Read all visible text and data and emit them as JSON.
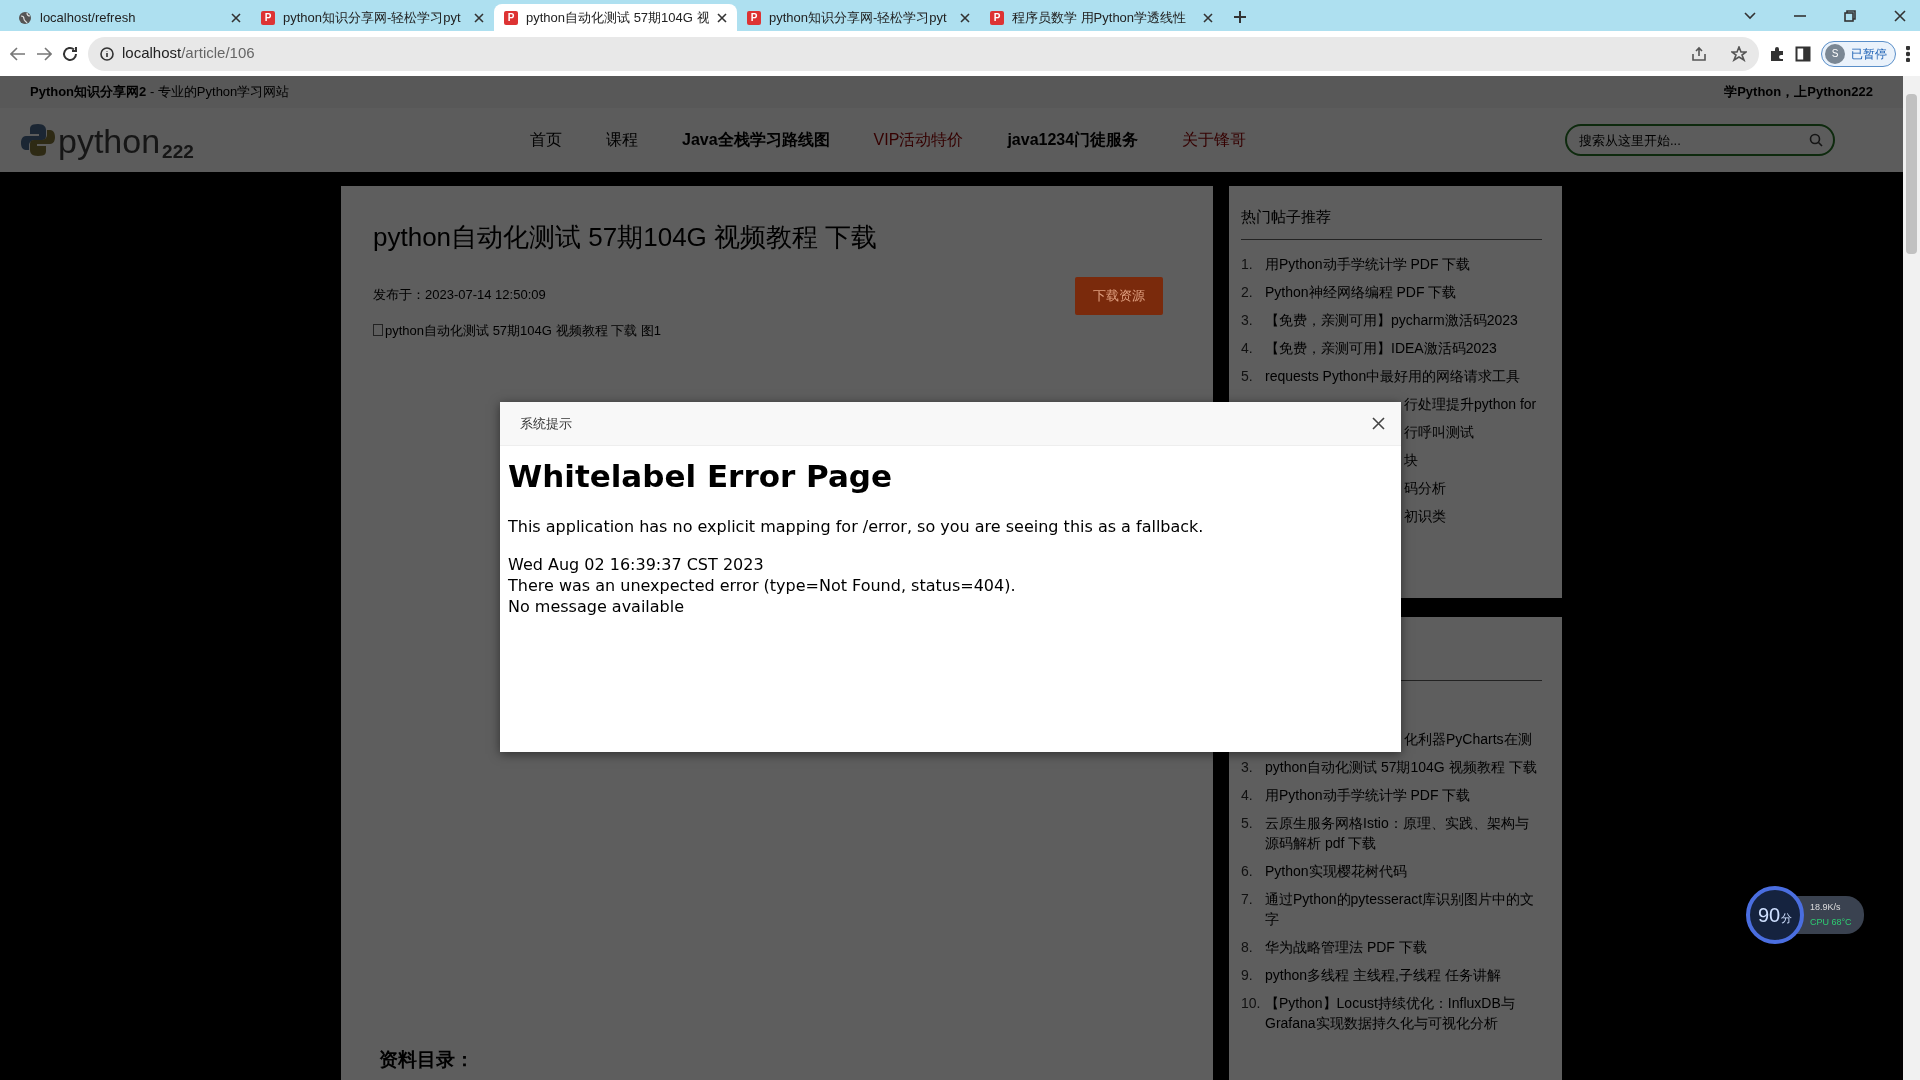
{
  "browser": {
    "tabs": [
      {
        "title": "localhost/refresh",
        "selected": false,
        "kind": "globe"
      },
      {
        "title": "python知识分享网-轻松学习pyt",
        "selected": false,
        "favicon": "P"
      },
      {
        "title": "python自动化测试 57期104G 视",
        "selected": true,
        "favicon": "P"
      },
      {
        "title": "python知识分享网-轻松学习pyt",
        "selected": false,
        "favicon": "P"
      },
      {
        "title": "程序员数学 用Python学透线性",
        "selected": false,
        "favicon": "P"
      }
    ],
    "address_host": "localhost",
    "address_path": "/article/106",
    "profile_initial": "S",
    "profile_status": "已暂停"
  },
  "site": {
    "tagline": "**Python知识分享网2** - 专业的Python学习网站",
    "slogan": "学Python，上Python222",
    "logo_text": "python",
    "logo_sub": "222",
    "nav": [
      {
        "label": "首页",
        "kind": "plain"
      },
      {
        "label": "课程",
        "kind": "plain"
      },
      {
        "label": "Java全栈学习路线图",
        "kind": "bold"
      },
      {
        "label": "VIP活动特价",
        "kind": "red"
      },
      {
        "label": "java1234门徒服务",
        "kind": "bold"
      },
      {
        "label": "关于锋哥",
        "kind": "red"
      }
    ],
    "search_placeholder": "搜索从这里开始..."
  },
  "article": {
    "title": "python自动化测试 57期104G 视频教程 下载",
    "date": "发布于：2023-07-14 12:50:09",
    "download_button": "下载资源",
    "image_alt": "python自动化测试 57期104G 视频教程 下载 图1",
    "section_heading": "资料目录："
  },
  "sidebar": [
    {
      "title": "热门帖子推荐",
      "items": [
        {
          "kind": "full",
          "number": "1.",
          "text": "用Python动手学统计学 PDF 下载"
        },
        {
          "kind": "full",
          "number": "2.",
          "text": "Python神经网络编程 PDF 下载"
        },
        {
          "kind": "full",
          "number": "3.",
          "text": "【免费，亲测可用】pycharm激活码2023"
        },
        {
          "kind": "full",
          "number": "4.",
          "text": "【免费，亲测可用】IDEA激活码2023"
        },
        {
          "kind": "full",
          "number": "5.",
          "text": "requests Python中最好用的网络请求工具"
        },
        {
          "kind": "partial",
          "text": "行处理提升python for"
        },
        {
          "kind": "partial",
          "text": "行呼叫测试"
        },
        {
          "kind": "partial",
          "text": "块"
        },
        {
          "kind": "partial",
          "text": "码分析"
        },
        {
          "kind": "partial",
          "text": "初识类"
        }
      ]
    },
    {
      "items": [
        {
          "kind": "partial",
          "text": "化利器PyCharts在测"
        },
        {
          "kind": "full",
          "number": "3.",
          "text": "python自动化测试 57期104G 视频教程 下载"
        },
        {
          "kind": "full",
          "number": "4.",
          "text": "用Python动手学统计学 PDF 下载"
        },
        {
          "kind": "full",
          "number": "5.",
          "text": "云原生服务网格Istio：原理、实践、架构与源码解析 pdf 下载"
        },
        {
          "kind": "full",
          "number": "6.",
          "text": "Python实现樱花树代码"
        },
        {
          "kind": "full",
          "number": "7.",
          "text": "通过Python的pytesseract库识别图片中的文字"
        },
        {
          "kind": "full",
          "number": "8.",
          "text": "华为战略管理法 PDF 下载"
        },
        {
          "kind": "full",
          "number": "9.",
          "text": "python多线程 主线程,子线程 任务讲解"
        },
        {
          "kind": "full",
          "number": "10.",
          "text": "【Python】Locust持续优化：InfluxDB与Grafana实现数据持久化与可视化分析"
        }
      ]
    }
  ],
  "modal": {
    "title": "系统提示",
    "heading": "Whitelabel Error Page",
    "paragraph": "This application has no explicit mapping for /error, so you are seeing this as a fallback.",
    "lines": [
      "Wed Aug 02 16:39:37 CST 2023",
      "There was an unexpected error (type=Not Found, status=404).",
      "No message available"
    ]
  },
  "widget": {
    "score": "90",
    "unit": "分",
    "speed": "18.9K/s",
    "cpu": "CPU 68°C"
  }
}
